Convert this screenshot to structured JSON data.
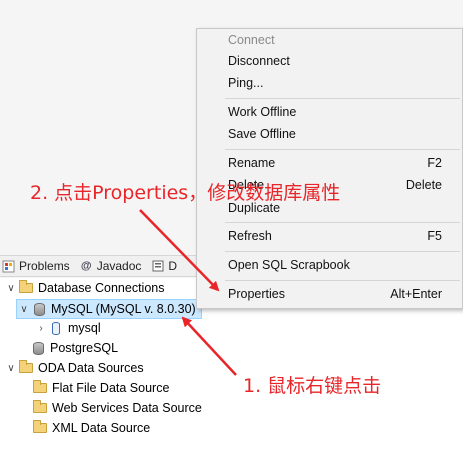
{
  "tabs": [
    {
      "label": "Problems",
      "icon": "problems-icon"
    },
    {
      "label": "Javadoc",
      "icon": "javadoc-icon"
    },
    {
      "label": "D",
      "icon": "declaration-icon"
    }
  ],
  "tree": {
    "database_connections": "Database Connections",
    "mysql_connection": "MySQL (MySQL v. 8.0.30)",
    "mysql_schema": "mysql",
    "postgresql": "PostgreSQL",
    "oda_data_sources": "ODA Data Sources",
    "flat_file": "Flat File Data Source",
    "web_services": "Web Services Data Source",
    "xml": "XML Data Source"
  },
  "context_menu": {
    "connect": "Connect",
    "disconnect": "Disconnect",
    "ping": "Ping...",
    "work_offline": "Work Offline",
    "save_offline": "Save Offline",
    "rename": "Rename",
    "rename_key": "F2",
    "delete": "Delete",
    "delete_key": "Delete",
    "duplicate": "Duplicate",
    "refresh": "Refresh",
    "refresh_key": "F5",
    "open_sql_scrapbook": "Open SQL Scrapbook",
    "properties": "Properties",
    "properties_key": "Alt+Enter"
  },
  "annotations": {
    "step2": "2. 点击Properties，修改数据库属性",
    "step1": "1. 鼠标右键点击",
    "color": "#e8262a"
  }
}
